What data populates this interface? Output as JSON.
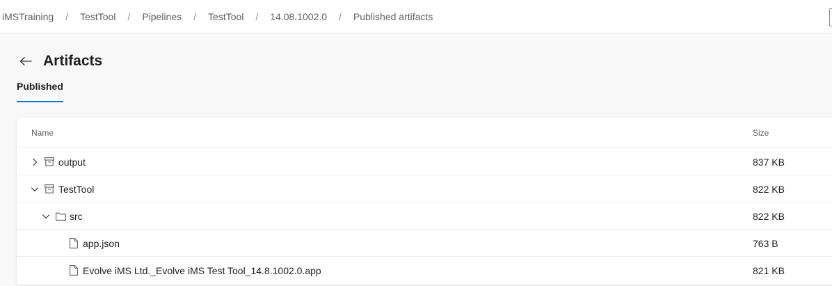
{
  "breadcrumbs": [
    "iMSTraining",
    "TestTool",
    "Pipelines",
    "TestTool",
    "14.08.1002.0",
    "Published artifacts"
  ],
  "breadcrumb_separator": "/",
  "page": {
    "title": "Artifacts"
  },
  "tabs": [
    {
      "label": "Published",
      "selected": true
    }
  ],
  "table": {
    "columns": {
      "name": "Name",
      "size": "Size"
    },
    "rows": [
      {
        "name": "output",
        "size": "837 KB",
        "kind": "artifact",
        "expanded": false,
        "level": 0
      },
      {
        "name": "TestTool",
        "size": "822 KB",
        "kind": "artifact",
        "expanded": true,
        "level": 0
      },
      {
        "name": "src",
        "size": "822 KB",
        "kind": "folder",
        "expanded": true,
        "level": 1
      },
      {
        "name": "app.json",
        "size": "763 B",
        "kind": "file",
        "level": 2
      },
      {
        "name": "Evolve iMS Ltd._Evolve iMS Test Tool_14.8.1002.0.app",
        "size": "821 KB",
        "kind": "file",
        "level": 2
      }
    ]
  },
  "colors": {
    "accent": "#0078d4",
    "text": "#201f1e",
    "secondary_text": "#605e5c",
    "background": "#f8f8f8"
  },
  "icons": {
    "back": "arrow-left-icon",
    "collapsed": "chevron-right-icon",
    "expanded": "chevron-down-icon",
    "artifact": "artifact-box-icon",
    "folder": "folder-icon",
    "file": "file-icon"
  }
}
